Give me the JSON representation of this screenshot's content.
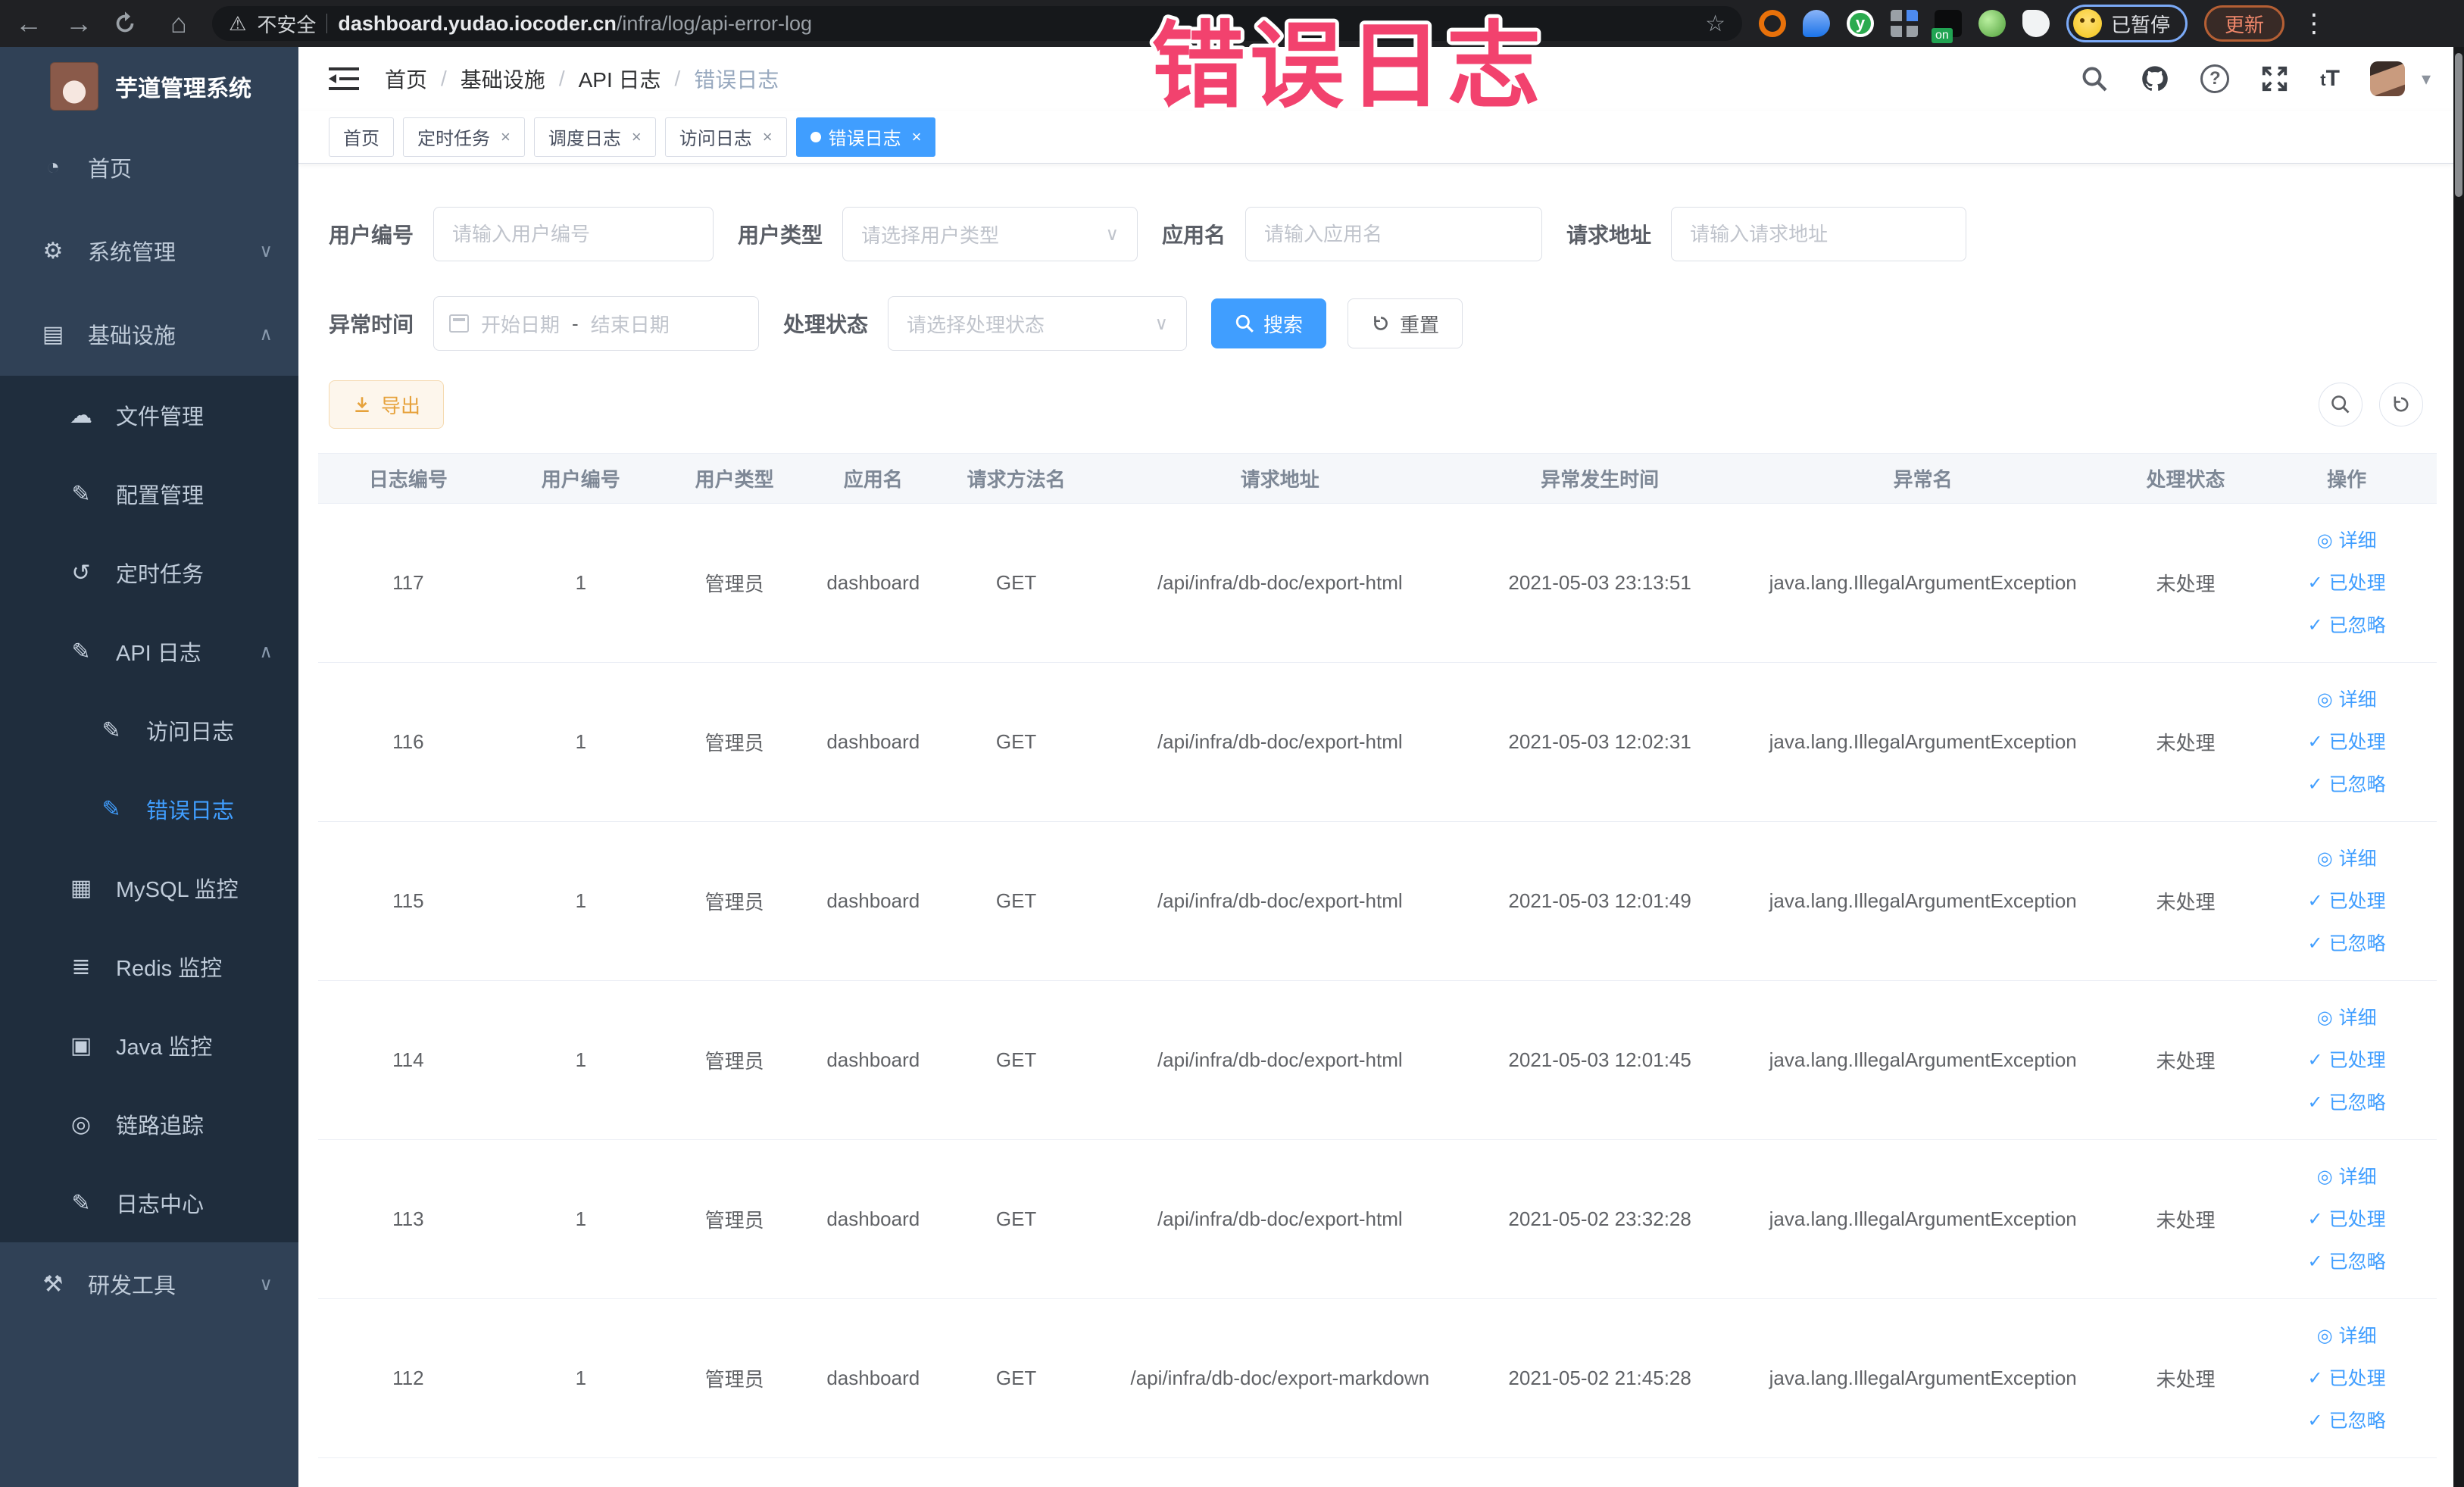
{
  "browser": {
    "security_label": "不安全",
    "url_host": "dashboard.yudao.iocoder.cn",
    "url_path": "/infra/log/api-error-log",
    "profile_status": "已暂停",
    "update_button": "更新"
  },
  "annotation": {
    "text": "错误日志",
    "color": "#f2426e"
  },
  "sidebar": {
    "app_title": "芋道管理系统",
    "items": [
      {
        "label": "首页"
      },
      {
        "label": "系统管理"
      },
      {
        "label": "基础设施"
      },
      {
        "label": "文件管理"
      },
      {
        "label": "配置管理"
      },
      {
        "label": "定时任务"
      },
      {
        "label": "API 日志"
      },
      {
        "label": "访问日志"
      },
      {
        "label": "错误日志"
      },
      {
        "label": "MySQL 监控"
      },
      {
        "label": "Redis 监控"
      },
      {
        "label": "Java 监控"
      },
      {
        "label": "链路追踪"
      },
      {
        "label": "日志中心"
      },
      {
        "label": "研发工具"
      }
    ]
  },
  "header": {
    "breadcrumb": [
      "首页",
      "基础设施",
      "API 日志",
      "错误日志"
    ]
  },
  "tags": [
    {
      "label": "首页"
    },
    {
      "label": "定时任务"
    },
    {
      "label": "调度日志"
    },
    {
      "label": "访问日志"
    },
    {
      "label": "错误日志"
    }
  ],
  "filters": {
    "user_id_label": "用户编号",
    "user_id_placeholder": "请输入用户编号",
    "user_type_label": "用户类型",
    "user_type_placeholder": "请选择用户类型",
    "app_name_label": "应用名",
    "app_name_placeholder": "请输入应用名",
    "request_url_label": "请求地址",
    "request_url_placeholder": "请输入请求地址",
    "time_label": "异常时间",
    "start_placeholder": "开始日期",
    "range_separator": "-",
    "end_placeholder": "结束日期",
    "status_label": "处理状态",
    "status_placeholder": "请选择处理状态",
    "search_label": "搜索",
    "reset_label": "重置"
  },
  "toolbar": {
    "export_label": "导出"
  },
  "table": {
    "columns": [
      {
        "key": "logId",
        "label": "日志编号"
      },
      {
        "key": "userId",
        "label": "用户编号"
      },
      {
        "key": "userType",
        "label": "用户类型"
      },
      {
        "key": "appName",
        "label": "应用名"
      },
      {
        "key": "method",
        "label": "请求方法名"
      },
      {
        "key": "url",
        "label": "请求地址"
      },
      {
        "key": "time",
        "label": "异常发生时间"
      },
      {
        "key": "exception",
        "label": "异常名"
      },
      {
        "key": "status",
        "label": "处理状态"
      },
      {
        "key": "actions",
        "label": "操作"
      }
    ],
    "row_actions": [
      "详细",
      "已处理",
      "已忽略"
    ],
    "rows": [
      {
        "logId": "117",
        "userId": "1",
        "userType": "管理员",
        "appName": "dashboard",
        "method": "GET",
        "url": "/api/infra/db-doc/export-html",
        "time": "2021-05-03 23:13:51",
        "exception": "java.lang.IllegalArgumentException",
        "status": "未处理"
      },
      {
        "logId": "116",
        "userId": "1",
        "userType": "管理员",
        "appName": "dashboard",
        "method": "GET",
        "url": "/api/infra/db-doc/export-html",
        "time": "2021-05-03 12:02:31",
        "exception": "java.lang.IllegalArgumentException",
        "status": "未处理"
      },
      {
        "logId": "115",
        "userId": "1",
        "userType": "管理员",
        "appName": "dashboard",
        "method": "GET",
        "url": "/api/infra/db-doc/export-html",
        "time": "2021-05-03 12:01:49",
        "exception": "java.lang.IllegalArgumentException",
        "status": "未处理"
      },
      {
        "logId": "114",
        "userId": "1",
        "userType": "管理员",
        "appName": "dashboard",
        "method": "GET",
        "url": "/api/infra/db-doc/export-html",
        "time": "2021-05-03 12:01:45",
        "exception": "java.lang.IllegalArgumentException",
        "status": "未处理"
      },
      {
        "logId": "113",
        "userId": "1",
        "userType": "管理员",
        "appName": "dashboard",
        "method": "GET",
        "url": "/api/infra/db-doc/export-html",
        "time": "2021-05-02 23:32:28",
        "exception": "java.lang.IllegalArgumentException",
        "status": "未处理"
      },
      {
        "logId": "112",
        "userId": "1",
        "userType": "管理员",
        "appName": "dashboard",
        "method": "GET",
        "url": "/api/infra/db-doc/export-markdown",
        "time": "2021-05-02 21:45:28",
        "exception": "java.lang.IllegalArgumentException",
        "status": "未处理"
      }
    ]
  }
}
